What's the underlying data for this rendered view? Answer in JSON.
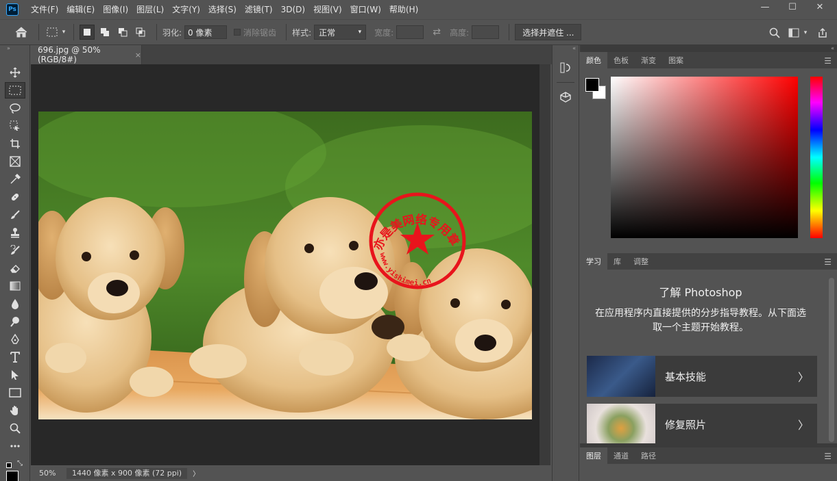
{
  "app": {
    "logo": "Ps"
  },
  "menu": [
    "文件(F)",
    "编辑(E)",
    "图像(I)",
    "图层(L)",
    "文字(Y)",
    "选择(S)",
    "滤镜(T)",
    "3D(D)",
    "视图(V)",
    "窗口(W)",
    "帮助(H)"
  ],
  "window": {
    "minimize": "—",
    "maximize": "☐",
    "close": "✕"
  },
  "options": {
    "feather_label": "羽化:",
    "feather_value": "0 像素",
    "antialias_label": "消除锯齿",
    "style_label": "样式:",
    "style_value": "正常",
    "width_label": "宽度:",
    "height_label": "高度:",
    "select_mask_button": "选择并遮住 ..."
  },
  "document": {
    "tab_title": "696.jpg @ 50%(RGB/8#)",
    "tab_close": "×",
    "zoom": "50%",
    "info": "1440 像素 x 900 像素 (72 ppi)",
    "info_chevron": "〉"
  },
  "watermark": {
    "text": "亦是美网络专用章 www.yishimei.cn",
    "color": "#e8141c"
  },
  "panels": {
    "color_tabs": [
      "颜色",
      "色板",
      "渐变",
      "图案"
    ],
    "learn_tabs": [
      "学习",
      "库",
      "调整"
    ],
    "layers_tabs": [
      "图层",
      "通道",
      "路径"
    ],
    "menu_icon": "☰"
  },
  "learn": {
    "title": "了解 Photoshop",
    "description": "在应用程序内直接提供的分步指导教程。从下面选取一个主题开始教程。",
    "cards": [
      {
        "label": "基本技能",
        "chevron": "〉"
      },
      {
        "label": "修复照片",
        "chevron": "〉"
      }
    ]
  },
  "colors": {
    "foreground": "#000000",
    "background": "#ffffff",
    "ui_bg": "#535353",
    "canvas_bg": "#282828"
  }
}
